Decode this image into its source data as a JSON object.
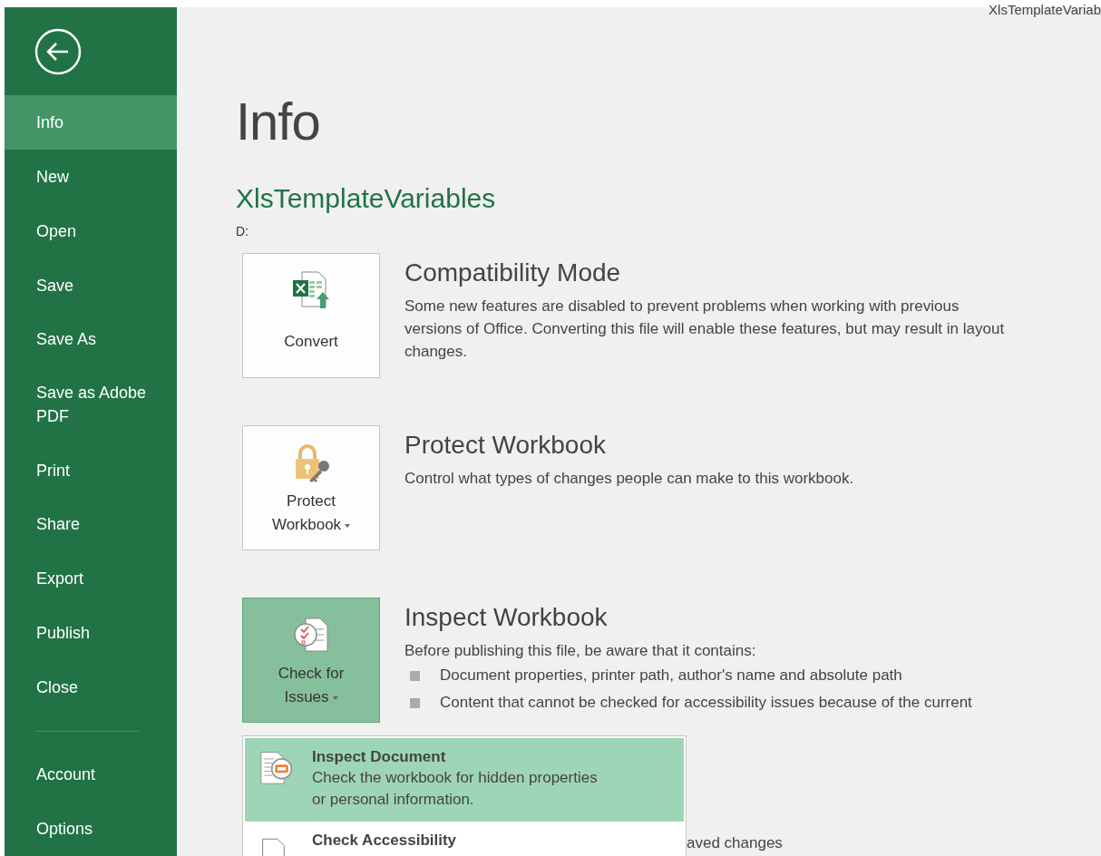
{
  "window": {
    "title": "XlsTemplateVariab"
  },
  "sidebar": {
    "items": [
      {
        "label": "Info",
        "selected": true
      },
      {
        "label": "New",
        "selected": false
      },
      {
        "label": "Open",
        "selected": false
      },
      {
        "label": "Save",
        "selected": false
      },
      {
        "label": "Save As",
        "selected": false
      },
      {
        "label": "Save as Adobe\nPDF",
        "selected": false
      },
      {
        "label": "Print",
        "selected": false
      },
      {
        "label": "Share",
        "selected": false
      },
      {
        "label": "Export",
        "selected": false
      },
      {
        "label": "Publish",
        "selected": false
      },
      {
        "label": "Close",
        "selected": false
      }
    ],
    "bottom_items": [
      {
        "label": "Account",
        "selected": false
      },
      {
        "label": "Options",
        "selected": false
      }
    ]
  },
  "page": {
    "title": "Info",
    "file_name": "XlsTemplateVariables",
    "file_path": "D:"
  },
  "sections": [
    {
      "button": {
        "label": "Convert",
        "dropdown": false,
        "expanded": false
      },
      "heading": "Compatibility Mode",
      "description": "Some new features are disabled to prevent problems when working with previous versions of Office. Converting this file will enable these features, but may result in layout changes."
    },
    {
      "button": {
        "label": "Protect\nWorkbook",
        "dropdown": true,
        "expanded": false
      },
      "heading": "Protect Workbook",
      "description": "Control what types of changes people can make to this workbook."
    },
    {
      "button": {
        "label": "Check for\nIssues",
        "dropdown": true,
        "expanded": true
      },
      "heading": "Inspect Workbook",
      "description": "Before publishing this file, be aware that it contains:",
      "bullets": [
        "Document properties, printer path, author's name and absolute path",
        "Content that cannot be checked for accessibility issues because of the current"
      ]
    }
  ],
  "hidden_text": "aved changes",
  "menu": {
    "items": [
      {
        "title": "Inspect Document",
        "description": "Check the workbook for hidden properties\nor personal information.",
        "selected": true
      },
      {
        "title": "Check Accessibility",
        "selected": false
      }
    ]
  }
}
